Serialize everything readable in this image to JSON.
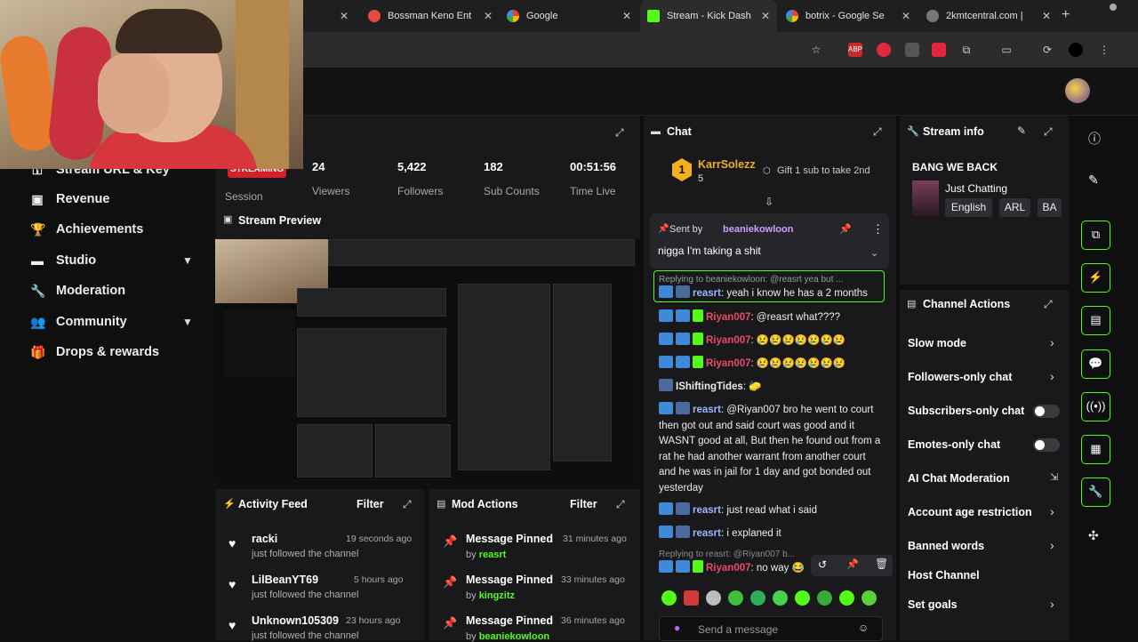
{
  "browser": {
    "tabs": [
      {
        "title": "",
        "active": false,
        "color": "#555555"
      },
      {
        "title": "Bossman Keno Ent",
        "active": false,
        "color": "#e5483d"
      },
      {
        "title": "Google",
        "active": false,
        "color": "#ffffff"
      },
      {
        "title": "Stream - Kick Dash",
        "active": true,
        "color": "#53fc18"
      },
      {
        "title": "botrix - Google Se",
        "active": false,
        "color": "#ffffff"
      },
      {
        "title": "2kmtcentral.com | ",
        "active": false,
        "color": "#999999"
      }
    ],
    "new_tab": "+"
  },
  "sidebar": {
    "items": [
      {
        "label": "Stream URL & Key",
        "icon": "key-icon"
      },
      {
        "label": "Revenue",
        "icon": "wallet-icon"
      },
      {
        "label": "Achievements",
        "icon": "trophy-icon"
      },
      {
        "label": "Studio",
        "icon": "studio-icon"
      },
      {
        "label": "Moderation",
        "icon": "wrench-icon"
      },
      {
        "label": "Community",
        "icon": "people-icon"
      },
      {
        "label": "Drops & rewards",
        "icon": "gift-icon"
      }
    ]
  },
  "stats": {
    "live_badge": "STREAMING",
    "session_label": "Session",
    "viewers": {
      "value": "24",
      "label": "Viewers"
    },
    "followers": {
      "value": "5,422",
      "label": "Followers"
    },
    "subs": {
      "value": "182",
      "label": "Sub Counts"
    },
    "time": {
      "value": "00:51:56",
      "label": "Time Live"
    }
  },
  "preview": {
    "title": "Stream Preview"
  },
  "activity": {
    "title": "Activity Feed",
    "filter": "Filter",
    "items": [
      {
        "name": "racki",
        "action": "just followed the channel",
        "time": "19 seconds ago"
      },
      {
        "name": "LilBeanYT69",
        "action": "just followed the channel",
        "time": "5 hours ago"
      },
      {
        "name": "Unknown105309",
        "action": "just followed the channel",
        "time": "23 hours ago"
      }
    ]
  },
  "mod_actions": {
    "title": "Mod Actions",
    "filter": "Filter",
    "items": [
      {
        "title": "Message Pinned",
        "by_prefix": "by",
        "by": "reasrt",
        "time": "31 minutes ago"
      },
      {
        "title": "Message Pinned",
        "by_prefix": "by",
        "by": "kingzitz",
        "time": "33 minutes ago"
      },
      {
        "title": "Message Pinned",
        "by_prefix": "by",
        "by": "beaniekowloon",
        "time": "36 minutes ago"
      }
    ]
  },
  "chat": {
    "title": "Chat",
    "top_gifter": {
      "rank": "1",
      "name": "KarrSolezz",
      "count": "5"
    },
    "gift_prompt": "Gift 1 sub to take 2nd",
    "pinned": {
      "sent_by": "Sent by",
      "user": "beaniekowloon",
      "text": "nigga I'm taking a shit"
    },
    "reply_banner": "Replying to beaniekowloon: @reasrt yea but ...",
    "messages": [
      {
        "user": "reasrt",
        "color": "#9ab7ff",
        "text": "yeah i know he has a 2 months"
      },
      {
        "user": "Riyan007",
        "color": "#e84a6a",
        "text": "@reasrt what????"
      },
      {
        "user": "Riyan007",
        "color": "#e84a6a",
        "text": "😢😢😢😢😢😢😢"
      },
      {
        "user": "Riyan007",
        "color": "#e84a6a",
        "text": "😢😢😢😢😢😢😢"
      },
      {
        "user": "IShiftingTides",
        "color": "#ffffff",
        "text": "🧽"
      },
      {
        "user": "reasrt",
        "color": "#9ab7ff",
        "text": "@Riyan007 bro he went to court then got out and said court was good and it WASNT good at all, But then he found out from a rat he had another warrant from another court and he was in jail for 1 day and got bonded out yesterday"
      },
      {
        "user": "reasrt",
        "color": "#9ab7ff",
        "text": "just read what i said"
      },
      {
        "user": "reasrt",
        "color": "#9ab7ff",
        "text": "i explaned it"
      },
      {
        "user": "Riyan007",
        "color": "#e84a6a",
        "text": "no way 😂"
      }
    ],
    "reply_banner_2": "Replying to reasrt: @Riyan007 b...",
    "input_placeholder": "Send a message"
  },
  "stream_info": {
    "title": "Stream info",
    "stream_title": "BANG WE BACK",
    "category": "Just Chatting",
    "tags": [
      "English",
      "ARL",
      "BA"
    ]
  },
  "channel_actions": {
    "title": "Channel Actions",
    "items": [
      {
        "label": "Slow mode",
        "control": "chevron"
      },
      {
        "label": "Followers-only chat",
        "control": "chevron"
      },
      {
        "label": "Subscribers-only chat",
        "control": "toggle"
      },
      {
        "label": "Emotes-only chat",
        "control": "toggle"
      },
      {
        "label": "AI Chat Moderation",
        "control": "external"
      },
      {
        "label": "Account age restriction",
        "control": "chevron"
      },
      {
        "label": "Banned words",
        "control": "chevron"
      },
      {
        "label": "Host Channel",
        "control": "none"
      },
      {
        "label": "Set goals",
        "control": "chevron"
      }
    ]
  },
  "colors": {
    "accent": "#53fc18",
    "live": "#d1212b",
    "panel": "#19191b"
  }
}
